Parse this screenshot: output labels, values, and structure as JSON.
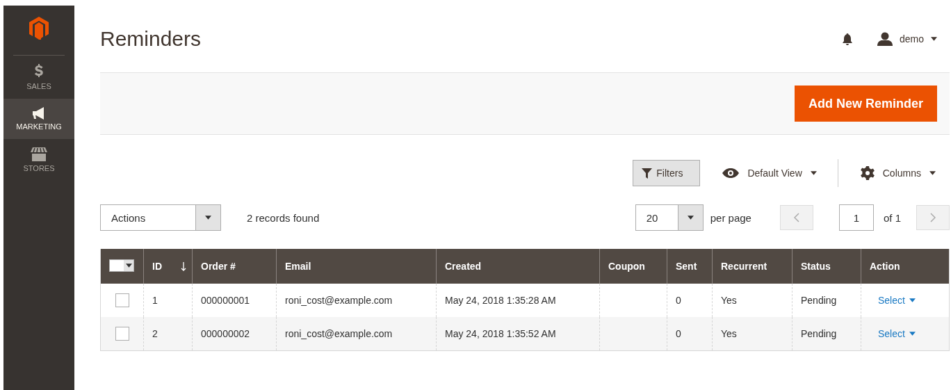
{
  "sidebar": {
    "items": [
      {
        "label": "SALES",
        "selected": false
      },
      {
        "label": "MARKETING",
        "selected": true
      },
      {
        "label": "STORES",
        "selected": false
      }
    ]
  },
  "header": {
    "title": "Reminders",
    "user": "demo"
  },
  "primary_button": "Add New Reminder",
  "toolbar": {
    "filters": "Filters",
    "view": "Default View",
    "columns": "Columns",
    "actions": "Actions",
    "records": "2 records found",
    "per_page": "20",
    "per_page_label": "per page",
    "page": "1",
    "page_total": "of 1"
  },
  "table": {
    "columns": [
      {
        "label": "ID",
        "sorted": true
      },
      {
        "label": "Order #",
        "sorted": false
      },
      {
        "label": "Email",
        "sorted": false
      },
      {
        "label": "Created",
        "sorted": false
      },
      {
        "label": "Coupon",
        "sorted": false
      },
      {
        "label": "Sent",
        "sorted": false
      },
      {
        "label": "Recurrent",
        "sorted": false
      },
      {
        "label": "Status",
        "sorted": false
      },
      {
        "label": "Action",
        "sorted": false
      }
    ],
    "rows": [
      {
        "checked": false,
        "cells": [
          "1",
          "000000001",
          "roni_cost@example.com",
          "May 24, 2018 1:35:28 AM",
          "",
          "0",
          "Yes",
          "Pending"
        ],
        "action": "Select"
      },
      {
        "checked": false,
        "cells": [
          "2",
          "000000002",
          "roni_cost@example.com",
          "May 24, 2018 1:35:52 AM",
          "",
          "0",
          "Yes",
          "Pending"
        ],
        "action": "Select"
      }
    ]
  }
}
